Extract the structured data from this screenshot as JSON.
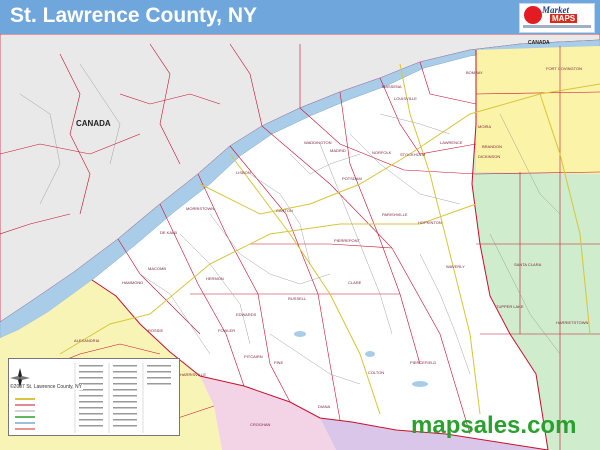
{
  "header": {
    "title": "St. Lawrence County, NY",
    "logo_word_1": "Market",
    "logo_word_2": "MAPS"
  },
  "map": {
    "canada_label_main": "CANADA",
    "canada_label_top": "CANADA",
    "town_labels": [
      "BOMBAY",
      "FORT COVINGTON",
      "LAWRENCE",
      "MOIRA",
      "BRANDON",
      "DICKINSON",
      "HOPKINTON",
      "WAVERLY",
      "SANTA CLARA",
      "TUPPER LAKE",
      "HARRIETSTOWN",
      "CANTON",
      "POTSDAM",
      "DE KALB",
      "MACOMB",
      "HERMON",
      "PIERREPONT",
      "CLARE",
      "FOWLER",
      "EDWARDS",
      "FINE",
      "PIERCEFIELD",
      "COLTON",
      "HARRISVILLE",
      "ALEXANDRIA",
      "ROSSIE",
      "PITCAIRN",
      "RUSSELL",
      "PARISHVILLE",
      "LISBON",
      "WADDINGTON",
      "MADRID",
      "NORFOLK",
      "STOCKHOLM",
      "HAMMOND",
      "MORRISTOWN",
      "LOUISVILLE",
      "MASSENA",
      "DIANA",
      "CROGHAN",
      "WILNA"
    ],
    "icon": "compass-rose-icon"
  },
  "legend": {
    "copyright": "©2007 St. Lawrence County, NY"
  },
  "footer": {
    "brand": "mapsales.com"
  },
  "colors": {
    "title_bar": "#6fa6dc",
    "water": "#a9cde8",
    "canada_land": "#e9e9e9",
    "county_land": "#ffffff",
    "franklin_green": "#cfeccc",
    "clinton_yellow": "#fbf3a8",
    "jefferson_yellow": "#f8f4b6",
    "lewis_pink": "#f3d3e6",
    "herkimer_purple": "#d9c6e8",
    "boundary_red": "#c8102e",
    "road_yellow": "#d8c53a",
    "brand_green": "#2aa12e"
  }
}
